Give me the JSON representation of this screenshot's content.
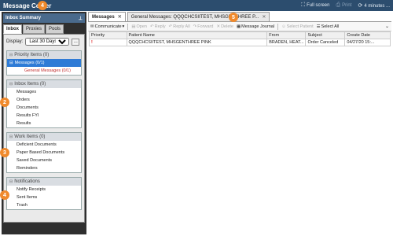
{
  "titlebar": {
    "title": "Message Center",
    "fullscreen": "Full screen",
    "print": "Print",
    "refresh": "4 minutes ..."
  },
  "badges": [
    "4",
    "5",
    "2",
    "3",
    "4"
  ],
  "sidebar": {
    "header": "Inbox Summary",
    "tabs": [
      "Inbox",
      "Proxies",
      "Pools"
    ],
    "display_label": "Display:",
    "display_value": "Last 30 Days",
    "dots": "...",
    "groups": [
      {
        "title": "Priority Items (0)",
        "items": [
          {
            "label": "Messages (0/1)",
            "selected": true
          },
          {
            "label": "General Messages (0/1)",
            "sub": true
          }
        ]
      },
      {
        "title": "Inbox Items (0)",
        "items": [
          {
            "label": "Messages"
          },
          {
            "label": "Orders"
          },
          {
            "label": "Documents"
          },
          {
            "label": "Results FYI"
          },
          {
            "label": "Results"
          }
        ]
      },
      {
        "title": "Work Items (0)",
        "items": [
          {
            "label": "Deficient Documents"
          },
          {
            "label": "Paper Based Documents"
          },
          {
            "label": "Saved Documents"
          },
          {
            "label": "Reminders"
          }
        ]
      },
      {
        "title": "Notifications",
        "items": [
          {
            "label": "Notify Receipts"
          },
          {
            "label": "Sent Items"
          },
          {
            "label": "Trash"
          }
        ]
      }
    ]
  },
  "main": {
    "tabs": [
      {
        "label": "Messages",
        "active": true
      },
      {
        "label": "General Messages: QQQCHCSIITEST, MHSGENTHREE P...",
        "active": false
      }
    ],
    "toolbar": {
      "communicate": "Communicate",
      "open": "Open",
      "reply": "Reply",
      "reply_all": "Reply All",
      "forward": "Forward",
      "delete": "Delete",
      "message_journal": "Message Journal",
      "select_patient": "Select Patient",
      "select_all": "Select All"
    },
    "columns": [
      "Priority",
      "Patient Name",
      "From",
      "Subject",
      "Create Date"
    ],
    "rows": [
      {
        "priority": "!",
        "patient": "QQQCHCSIITEST, MHSGENTHREE PINK",
        "from": "BRADEN, HEAT...",
        "subject": "Order Canceled",
        "date": "04/27/20 15:..."
      }
    ]
  }
}
